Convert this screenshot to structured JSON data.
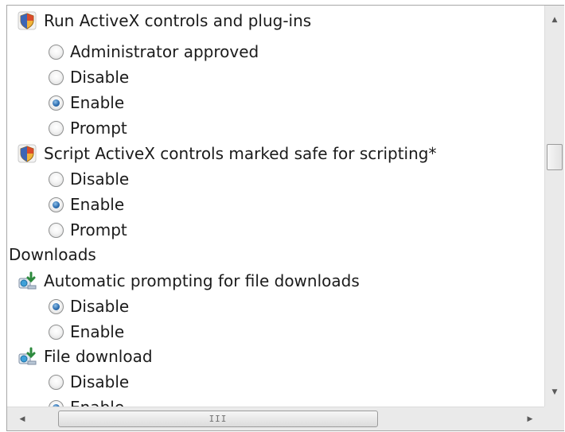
{
  "settings": {
    "run_activex": {
      "title": "Run ActiveX controls and plug-ins",
      "icon": "activex-shield-icon",
      "options": [
        {
          "label": "Administrator approved",
          "checked": false
        },
        {
          "label": "Disable",
          "checked": false
        },
        {
          "label": "Enable",
          "checked": true
        },
        {
          "label": "Prompt",
          "checked": false
        }
      ]
    },
    "script_activex": {
      "title": "Script ActiveX controls marked safe for scripting*",
      "icon": "activex-shield-icon",
      "options": [
        {
          "label": "Disable",
          "checked": false
        },
        {
          "label": "Enable",
          "checked": true
        },
        {
          "label": "Prompt",
          "checked": false
        }
      ]
    },
    "downloads_category": "Downloads",
    "auto_prompting": {
      "title": "Automatic prompting for file downloads",
      "icon": "download-settings-icon",
      "options": [
        {
          "label": "Disable",
          "checked": true
        },
        {
          "label": "Enable",
          "checked": false
        }
      ]
    },
    "file_download": {
      "title": "File download",
      "icon": "download-settings-icon",
      "options": [
        {
          "label": "Disable",
          "checked": false
        },
        {
          "label": "Enable",
          "checked": true
        }
      ]
    }
  },
  "scrollbars": {
    "up_arrow": "▲",
    "down_arrow": "▼",
    "left_arrow": "◀",
    "right_arrow": "▶",
    "grip": "III"
  }
}
